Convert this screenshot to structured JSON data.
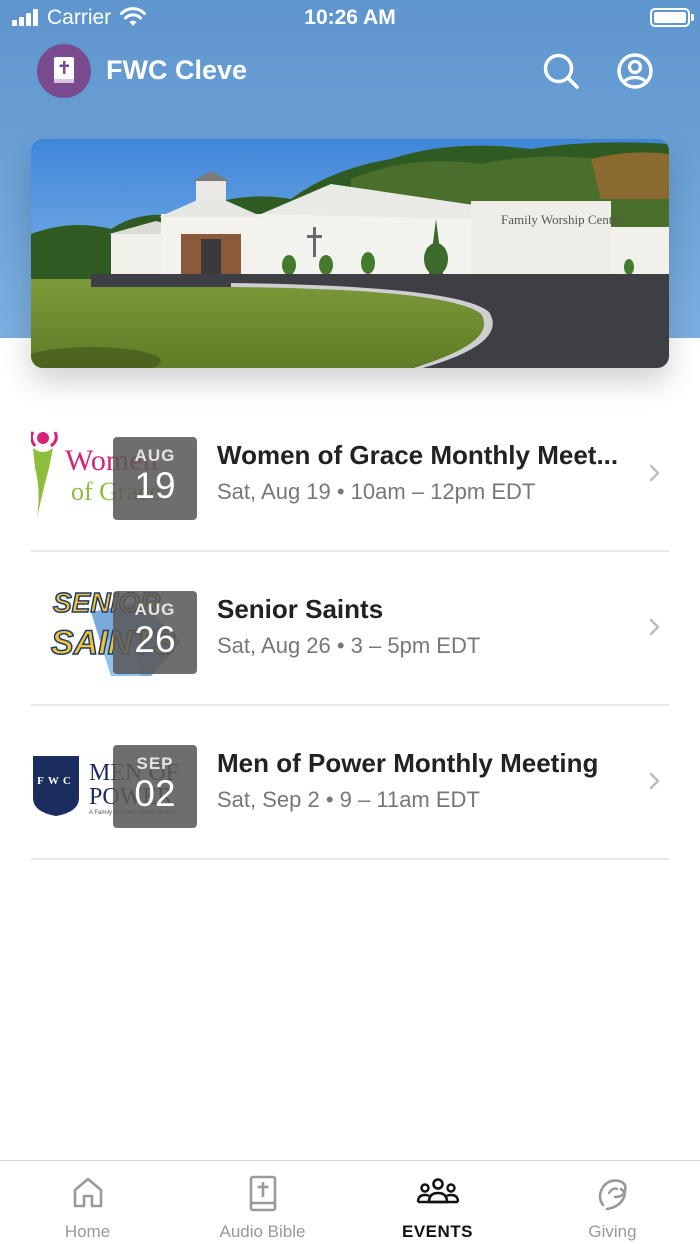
{
  "status_bar": {
    "carrier": "Carrier",
    "time": "10:26 AM"
  },
  "app": {
    "title": "FWC Cleve"
  },
  "colors": {
    "header": "#6aa0d6",
    "logo_bg": "#7b4b8f",
    "badge": "#5a5a5a"
  },
  "hero": {
    "sign_text": "Family Worship Center"
  },
  "events": [
    {
      "title": "Women of Grace Monthly Meet...",
      "subtitle": "Sat, Aug 19 • 10am – 12pm EDT",
      "month": "AUG",
      "day": "19",
      "thumb_text_1": "Women",
      "thumb_text_2": "of Grace"
    },
    {
      "title": "Senior Saints",
      "subtitle": "Sat, Aug 26 • 3 – 5pm EDT",
      "month": "AUG",
      "day": "26",
      "thumb_text_1": "SENIOR",
      "thumb_text_2": "SAINTS"
    },
    {
      "title": "Men of Power Monthly Meeting",
      "subtitle": "Sat, Sep 2 • 9 – 11am EDT",
      "month": "SEP",
      "day": "02",
      "thumb_text_1": "MEN OF",
      "thumb_text_2": "POWER",
      "thumb_text_3": "A Family Worship Center Ministry",
      "shield_text": "FWC"
    }
  ],
  "tabs": [
    {
      "label": "Home",
      "icon": "home-icon"
    },
    {
      "label": "Audio Bible",
      "icon": "bible-icon"
    },
    {
      "label": "EVENTS",
      "icon": "people-icon",
      "active": true
    },
    {
      "label": "Giving",
      "icon": "giving-icon"
    }
  ]
}
